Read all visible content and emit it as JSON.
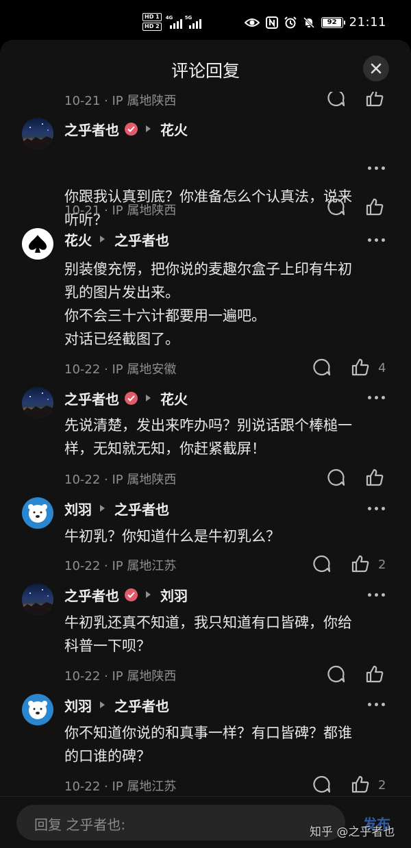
{
  "status_bar": {
    "hd1": "HD 1",
    "hd2": "HD 2",
    "net1": "4G",
    "net2": "5G",
    "battery": "92",
    "time": "21:11"
  },
  "sheet": {
    "title": "评论回复"
  },
  "top_partial": {
    "meta": "10-21 · IP 属地陕西"
  },
  "comments": [
    {
      "author": "之乎者也",
      "verified": true,
      "reply_to": "花火",
      "lines": [
        "你跟我认真到底？你准备怎么个认真法，说来",
        "听听？"
      ],
      "meta": "10-21 · IP 属地陕西",
      "likes": ""
    },
    {
      "author": "花火",
      "verified": false,
      "reply_to": "之乎者也",
      "lines": [
        "别装傻充愣，把你说的麦趣尔盒子上印有牛初",
        "乳的图片发出来。",
        "你不会三十六计都要用一遍吧。",
        "对话已经截图了。"
      ],
      "meta": "10-22 · IP 属地安徽",
      "likes": "4"
    },
    {
      "author": "之乎者也",
      "verified": true,
      "reply_to": "花火",
      "lines": [
        "先说清楚，发出来咋办吗？别说话跟个棒槌一",
        "样，无知就无知，你赶紧截屏！"
      ],
      "meta": "10-22 · IP 属地陕西",
      "likes": ""
    },
    {
      "author": "刘羽",
      "verified": false,
      "reply_to": "之乎者也",
      "lines": [
        "牛初乳？你知道什么是牛初乳么？"
      ],
      "meta": "10-22 · IP 属地江苏",
      "likes": "2"
    },
    {
      "author": "之乎者也",
      "verified": true,
      "reply_to": "刘羽",
      "lines": [
        "牛初乳还真不知道，我只知道有口皆碑，你给",
        "科普一下呗？"
      ],
      "meta": "10-22 · IP 属地陕西",
      "likes": ""
    },
    {
      "author": "刘羽",
      "verified": false,
      "reply_to": "之乎者也",
      "lines": [
        "你不知道你说的和真事一样？有口皆碑？都谁",
        "的口谁的碑？"
      ],
      "meta": "10-22 · IP 属地江苏",
      "likes": "2"
    }
  ],
  "bottom_bar": {
    "placeholder": "回复 之乎者也:",
    "send_label": "发布"
  },
  "watermark": "知乎 @之乎者也",
  "colors": {
    "background": "#121212",
    "verified_badge": "#e25b6a",
    "send": "#2c5da5"
  }
}
